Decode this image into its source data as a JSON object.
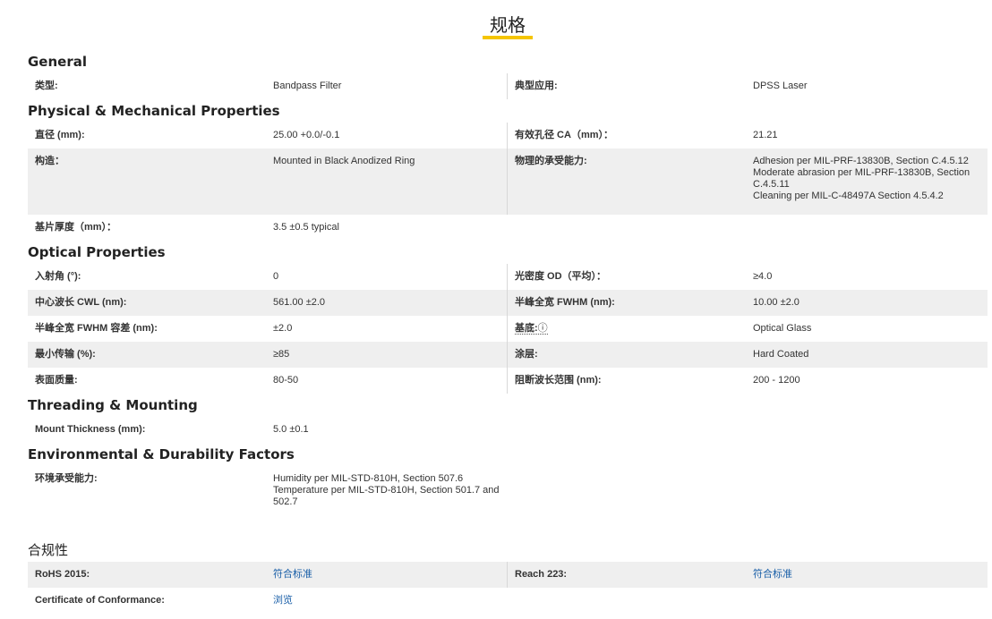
{
  "page": {
    "title": "规格"
  },
  "sections": {
    "general": {
      "heading": "General",
      "rows": [
        {
          "l1": "类型:",
          "v1": "Bandpass Filter",
          "l2": "典型应用:",
          "v2": "DPSS Laser"
        }
      ]
    },
    "physical": {
      "heading": "Physical & Mechanical Properties",
      "rows": [
        {
          "l1": "直径 (mm):",
          "v1": "25.00 +0.0/-0.1",
          "l2": "有效孔径 CA（mm）：",
          "v2": "21.21"
        },
        {
          "l1": "构造：",
          "v1": "Mounted in Black Anodized Ring",
          "l2": "物理的承受能力:",
          "v2_lines": [
            "Adhesion per MIL-PRF-13830B, Section C.4.5.12",
            "Moderate abrasion per MIL-PRF-13830B, Section C.4.5.11",
            "Cleaning per MIL-C-48497A Section 4.5.4.2"
          ]
        },
        {
          "l1": "基片厚度（mm）：",
          "v1": "3.5 ±0.5 typical"
        }
      ]
    },
    "optical": {
      "heading": "Optical Properties",
      "rows": [
        {
          "l1": "入射角 (°):",
          "v1": "0",
          "l2": "光密度 OD（平均）：",
          "v2": "≥4.0"
        },
        {
          "l1": "中心波长 CWL (nm):",
          "v1": "561.00 ±2.0",
          "l2": "半峰全宽 FWHM (nm):",
          "v2": "10.00 ±2.0"
        },
        {
          "l1": "半峰全宽 FWHM 容差 (nm):",
          "v1": "±2.0",
          "l2": "基底:",
          "l2_icon": "ⓘ",
          "v2": "Optical Glass"
        },
        {
          "l1": "最小传输 (%):",
          "v1": "≥85",
          "l2": "涂层:",
          "v2": "Hard Coated"
        },
        {
          "l1": "表面质量:",
          "v1": "80-50",
          "l2": "阻断波长范围 (nm):",
          "v2": "200 - 1200"
        }
      ]
    },
    "threading": {
      "heading": "Threading & Mounting",
      "rows": [
        {
          "l1": "Mount Thickness (mm):",
          "v1": "5.0 ±0.1"
        }
      ]
    },
    "environmental": {
      "heading": "Environmental & Durability Factors",
      "rows": [
        {
          "l1": "环境承受能力:",
          "v1_lines": [
            "Humidity per MIL-STD-810H, Section 507.6",
            "Temperature per MIL-STD-810H, Section 501.7 and 502.7"
          ]
        }
      ]
    },
    "compliance": {
      "heading": "合规性",
      "rows": [
        {
          "l1": "RoHS 2015:",
          "v1": "符合标准",
          "l2": "Reach 223:",
          "v2": "符合标准"
        },
        {
          "l1": "Certificate of Conformance:",
          "v1": "浏览"
        }
      ]
    }
  },
  "colors": {
    "accent": "#f5c500",
    "link": "#1a5fa8",
    "row_shade": "#efefef"
  }
}
